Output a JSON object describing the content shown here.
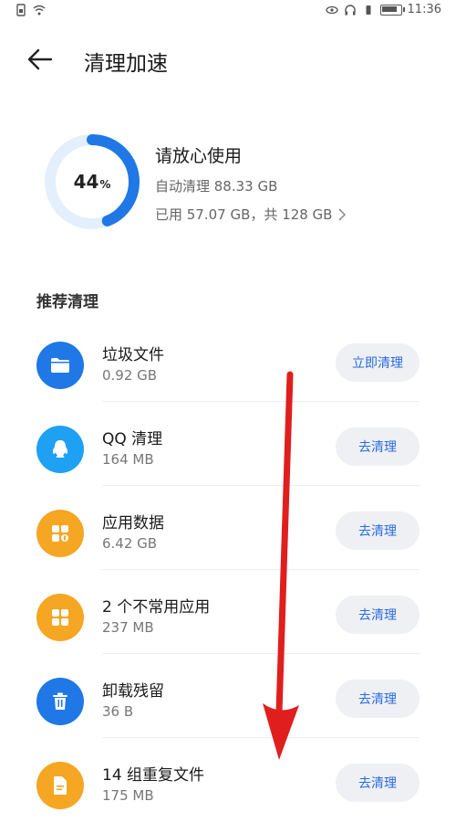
{
  "status_bar": {
    "time": "11:36"
  },
  "header": {
    "title": "清理加速"
  },
  "storage": {
    "percent_value": 44,
    "percent_number": "44",
    "percent_symbol": "%",
    "status_title": "请放心使用",
    "auto_clean": "自动清理 88.33 GB",
    "usage": "已用 57.07 GB，共 128 GB"
  },
  "section": {
    "title": "推荐清理"
  },
  "items": [
    {
      "name": "垃圾文件",
      "size": "0.92 GB",
      "action": "立即清理",
      "icon": "folder-icon",
      "color": "#1f78e5"
    },
    {
      "name": "QQ 清理",
      "size": "164 MB",
      "action": "去清理",
      "icon": "qq-icon",
      "color": "#1ea1f2"
    },
    {
      "name": "应用数据",
      "size": "6.42 GB",
      "action": "去清理",
      "icon": "app-data-icon",
      "color": "#f5a623"
    },
    {
      "name": "2 个不常用应用",
      "size": "237 MB",
      "action": "去清理",
      "icon": "apps-grid-icon",
      "color": "#f5a623"
    },
    {
      "name": "卸载残留",
      "size": "36 B",
      "action": "去清理",
      "icon": "trash-icon",
      "color": "#1f78e5"
    },
    {
      "name": "14 组重复文件",
      "size": "175 MB",
      "action": "去清理",
      "icon": "document-icon",
      "color": "#f5a623"
    }
  ],
  "colors": {
    "accent": "#2a6be0",
    "ring_fill": "#1f78e5",
    "ring_track": "#e3effd",
    "annotation_arrow": "#e01e1e"
  }
}
